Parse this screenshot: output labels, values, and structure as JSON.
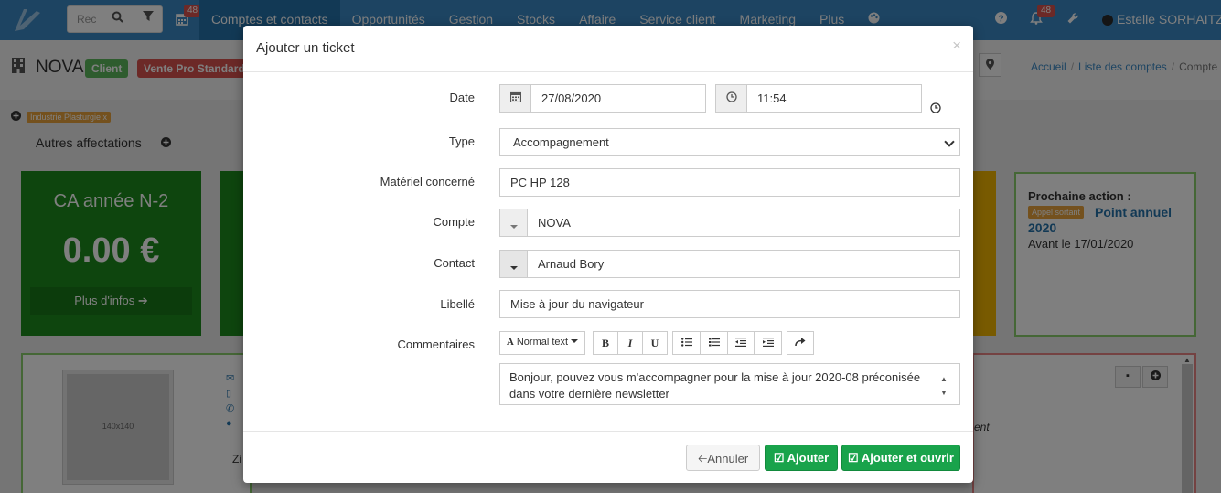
{
  "navbar": {
    "search_placeholder": "Rec",
    "calendar_badge": "48",
    "items": [
      "Comptes et contacts",
      "Opportunités",
      "Gestion",
      "Stocks",
      "Affaire",
      "Service client",
      "Marketing",
      "Plus"
    ],
    "bell_badge": "48",
    "user_name": "Estelle SORHAITZ"
  },
  "page": {
    "title": "NOVA",
    "label_client": "Client",
    "label_vente": "Vente Pro Standard",
    "breadcrumb": [
      "Accueil",
      "Liste des comptes",
      "Compte"
    ],
    "tag_industry": "Industrie Plasturgie x",
    "autres": "Autres affectations",
    "card_ca": {
      "title": "CA année N-2",
      "value": "0.00 €",
      "more": "Plus d'infos"
    },
    "next_action": {
      "title": "Prochaine action :",
      "tag": "Appel sortant",
      "link": "Point annuel 2020",
      "date": "Avant le 17/01/2020"
    },
    "photo_placeholder": "140x140",
    "zi_text": "Zi",
    "panel_right_text": "ent"
  },
  "modal": {
    "title": "Ajouter un ticket",
    "close": "×",
    "fields": {
      "date_label": "Date",
      "date_value": "27/08/2020",
      "time_value": "11:54",
      "type_label": "Type",
      "type_value": "Accompagnement",
      "materiel_label": "Matériel concerné",
      "materiel_value": "PC HP 128",
      "compte_label": "Compte",
      "compte_value": "NOVA",
      "contact_label": "Contact",
      "contact_value": "Arnaud Bory",
      "libelle_label": "Libellé",
      "libelle_value": "Mise à jour du navigateur",
      "commentaires_label": "Commentaires",
      "commentaires_value": "Bonjour, pouvez vous m'accompagner pour la mise à jour 2020-08 préconisée dans votre dernière newsletter"
    },
    "toolbar": {
      "text_style": "Normal text",
      "bold": "B",
      "italic": "I",
      "underline": "U"
    },
    "buttons": {
      "cancel": "Annuler",
      "add": "Ajouter",
      "add_open": "Ajouter et ouvrir"
    }
  },
  "colors": {
    "nav_blue": "#3a89c4",
    "nav_active": "#2472ab",
    "success": "#19a34b",
    "danger": "#d9534f",
    "warning": "#e8a33d"
  }
}
